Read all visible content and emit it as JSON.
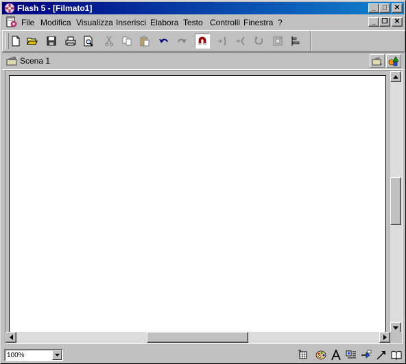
{
  "window": {
    "title": "Flash 5 - [Filmato1]",
    "buttons": {
      "minimize": "_",
      "maximize": "□",
      "close": "✕"
    },
    "doc_buttons": {
      "minimize": "_",
      "restore": "❐",
      "close": "✕"
    }
  },
  "menu": {
    "items": [
      {
        "label": "File"
      },
      {
        "label": "Modifica"
      },
      {
        "label": "Visualizza"
      },
      {
        "label": "Inserisci"
      },
      {
        "label": "Elabora"
      },
      {
        "label": "Testo"
      },
      {
        "label": "Controlli"
      },
      {
        "label": "Finestra"
      },
      {
        "label": "?"
      }
    ]
  },
  "toolbar": {
    "icons": [
      "new-file-icon",
      "open-folder-icon",
      "save-icon",
      "print-icon",
      "print-preview-icon",
      "cut-icon",
      "copy-icon",
      "paste-icon",
      "undo-icon",
      "redo-icon",
      "snap-magnet-icon",
      "smooth-icon",
      "straighten-icon",
      "rotate-icon",
      "scale-icon",
      "align-icon"
    ],
    "active": "snap-magnet-icon"
  },
  "scene": {
    "label": "Scena 1"
  },
  "status": {
    "zoom": "100%"
  },
  "colors": {
    "titlebar_start": "#000080",
    "titlebar_end": "#1084d0",
    "chrome": "#c0c0c0",
    "stage": "#ffffff"
  }
}
